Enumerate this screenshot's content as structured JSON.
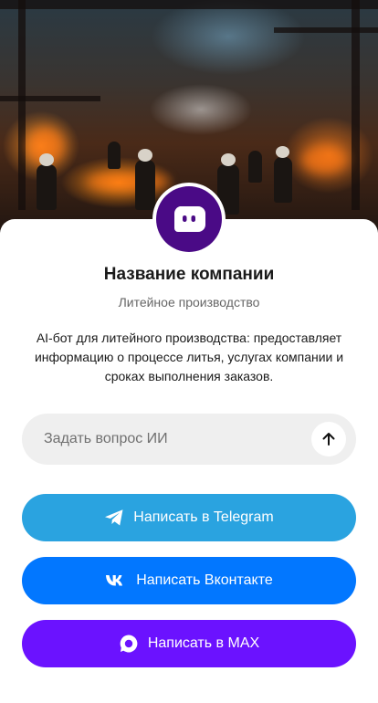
{
  "company": {
    "name": "Название компании",
    "category": "Литейное производство",
    "description": "AI-бот для литейного производства: предоставляет информацию о процессе литья, услугах компании и сроках выполнения заказов."
  },
  "ask": {
    "placeholder": "Задать вопрос ИИ"
  },
  "buttons": {
    "telegram": "Написать в Telegram",
    "vk": "Написать Вконтакте",
    "max": "Написать в MAX"
  },
  "colors": {
    "avatar": "#4a0a86",
    "telegram": "#2aa3e0",
    "vk": "#0277ff",
    "max": "#6b12ff",
    "ask_bg": "#efefef"
  },
  "icons": {
    "avatar": "bot-chat-icon",
    "send": "arrow-up-icon",
    "telegram": "telegram-icon",
    "vk": "vk-icon",
    "max": "max-icon"
  }
}
